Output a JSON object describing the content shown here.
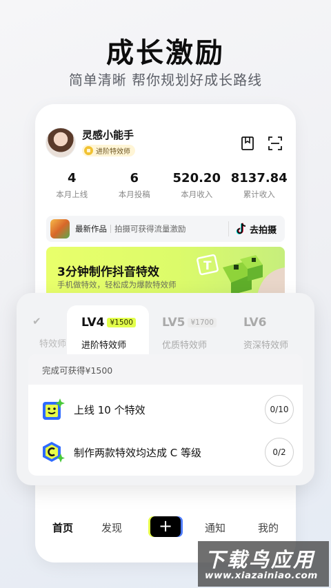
{
  "promo": {
    "title": "成长激励",
    "subtitle": "简单清晰 帮你规划好成长路线"
  },
  "profile": {
    "username": "灵感小能手",
    "level_badge": "进阶特效师"
  },
  "stats": [
    {
      "value": "4",
      "label": "本月上线"
    },
    {
      "value": "6",
      "label": "本月投稿"
    },
    {
      "value": "520.20",
      "label": "本月收入"
    },
    {
      "value": "8137.84",
      "label": "累计收入"
    }
  ],
  "works_bar": {
    "label": "最新作品",
    "desc": "拍摄可获得流量激励",
    "action": "去拍摄"
  },
  "banner": {
    "title": "3分钟制作抖音特效",
    "subtitle": "手机做特效，轻松成为爆款特效师"
  },
  "levels": {
    "prev_name": "特效师",
    "lv4": {
      "level": "LV4",
      "reward": "¥1500",
      "name": "进阶特效师"
    },
    "lv5": {
      "level": "LV5",
      "reward": "¥1700",
      "name": "优质特效师"
    },
    "lv6": {
      "level": "LV6",
      "name": "资深特效师"
    }
  },
  "tasks": {
    "header": "完成可获得¥1500",
    "items": [
      {
        "text": "上线 10 个特效",
        "progress": "0/10"
      },
      {
        "text": "制作两款特效均达成 C 等级",
        "progress": "0/2"
      }
    ]
  },
  "nav": {
    "home": "首页",
    "discover": "发现",
    "add": "+",
    "notify": "通知",
    "mine": "我的"
  },
  "watermark": {
    "title": "下载鸟应用",
    "url": "www.xiazainiao.com"
  },
  "colors": {
    "accent_lime": "#e2ff4a",
    "banner_green": "#dcfb6a",
    "nav_blue": "#4f7dff"
  }
}
